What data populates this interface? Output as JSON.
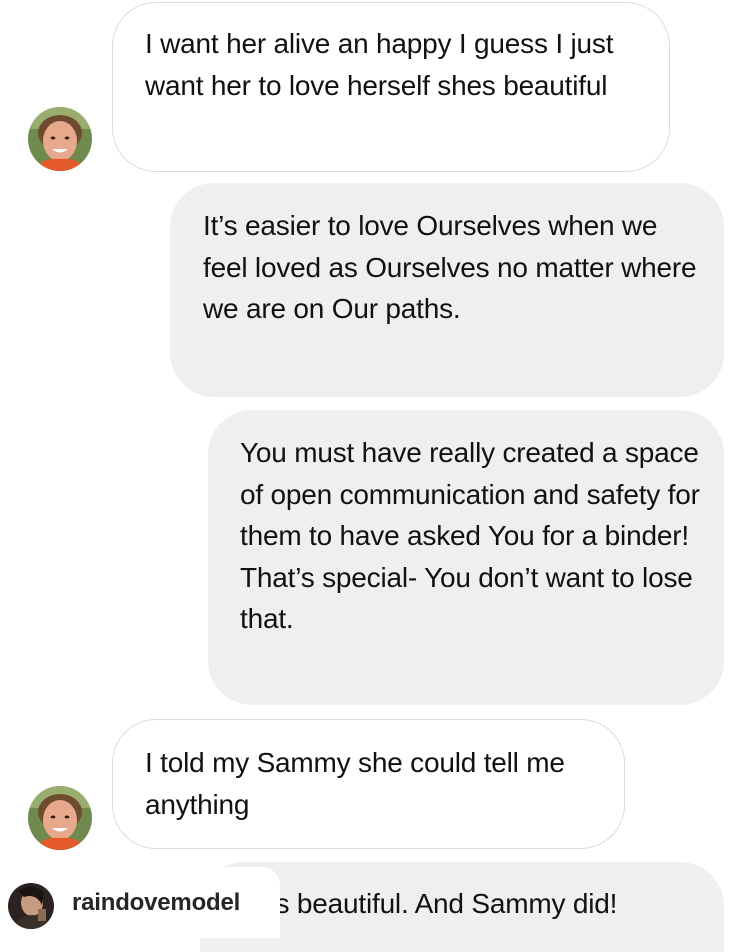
{
  "conversation": {
    "messages": [
      {
        "side": "incoming",
        "text": "I want her alive an happy I guess I just want her to love herself shes beautiful"
      },
      {
        "side": "outgoing",
        "text": "It’s easier to love Ourselves when we feel loved as Ourselves no matter where we are on Our paths."
      },
      {
        "side": "outgoing",
        "text": "You must have really created a space of open communication and safety for them to have asked You for a binder! That’s special- You don’t want to lose that."
      },
      {
        "side": "incoming",
        "text": "I told my Sammy she could tell me anything"
      },
      {
        "side": "outgoing",
        "text": "’s beautiful. And Sammy did!"
      }
    ]
  },
  "attribution": {
    "username": "raindovemodel"
  },
  "colors": {
    "incoming_bubble": "#ffffff",
    "incoming_border": "#dbdbdb",
    "outgoing_bubble": "#efefef",
    "text": "#111111"
  }
}
